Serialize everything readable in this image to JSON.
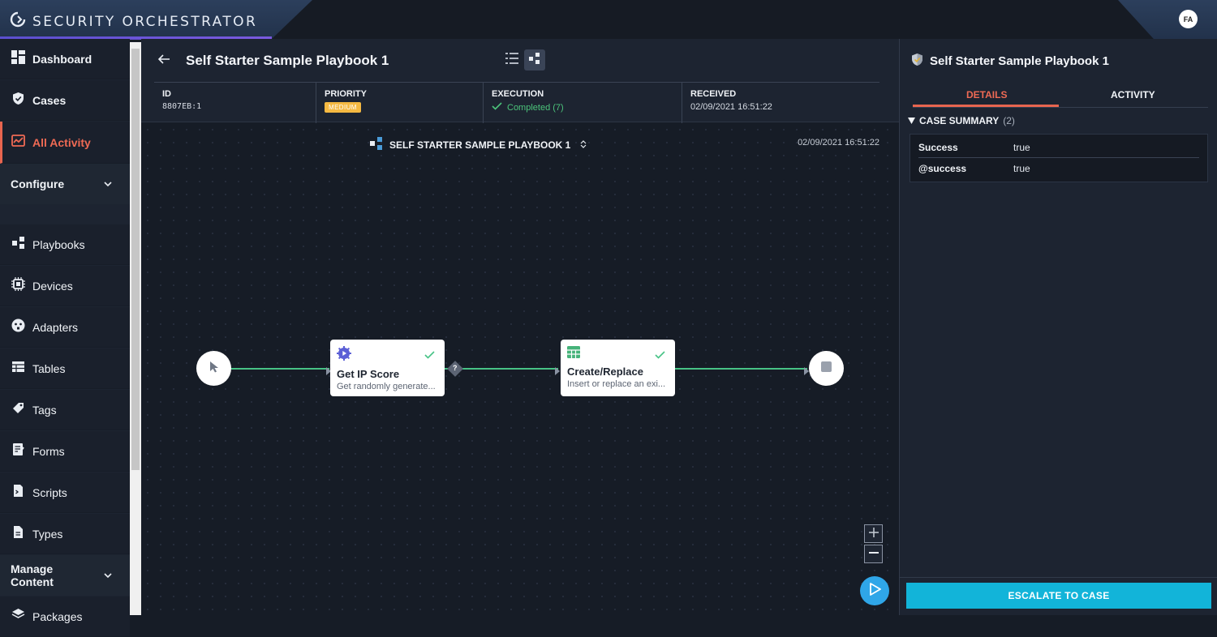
{
  "app": {
    "brand": "SECURITY ORCHESTRATOR",
    "user_initials": "FA"
  },
  "sidebar": {
    "items": [
      {
        "label": "Dashboard",
        "icon": "dashboard-icon"
      },
      {
        "label": "Cases",
        "icon": "shield-icon"
      },
      {
        "label": "All Activity",
        "icon": "activity-icon",
        "active": true
      }
    ],
    "configure_label": "Configure",
    "configure_items": [
      {
        "label": "Playbooks",
        "icon": "playbook-icon"
      },
      {
        "label": "Devices",
        "icon": "chip-icon"
      },
      {
        "label": "Adapters",
        "icon": "plug-icon"
      },
      {
        "label": "Tables",
        "icon": "table-icon"
      },
      {
        "label": "Tags",
        "icon": "tag-icon"
      },
      {
        "label": "Forms",
        "icon": "form-icon"
      },
      {
        "label": "Scripts",
        "icon": "script-icon"
      },
      {
        "label": "Types",
        "icon": "file-icon"
      }
    ],
    "manage_label": "Manage Content",
    "packages_label": "Packages"
  },
  "header": {
    "title": "Self Starter Sample Playbook 1",
    "id_label": "ID",
    "id_value": "8807EB:1",
    "priority_label": "PRIORITY",
    "priority_value": "MEDIUM",
    "execution_label": "EXECUTION",
    "execution_value": "Completed (7)",
    "received_label": "RECEIVED",
    "received_value": "02/09/2021 16:51:22"
  },
  "canvas": {
    "flow_name": "SELF STARTER SAMPLE PLAYBOOK 1",
    "flow_date": "02/09/2021 16:51:22",
    "nodes": [
      {
        "title": "Get IP Score",
        "desc": "Get randomly generate..."
      },
      {
        "title": "Create/Replace",
        "desc": "Insert or replace an exi..."
      }
    ],
    "decision_label": "?",
    "zoom_in": "+",
    "zoom_out": "—"
  },
  "panel": {
    "title": "Self Starter Sample Playbook 1",
    "tab_details": "DETAILS",
    "tab_activity": "ACTIVITY",
    "summary_label": "CASE SUMMARY",
    "summary_count": "(2)",
    "rows": [
      {
        "key": "Success",
        "value": "true"
      },
      {
        "key": "@success",
        "value": "true"
      }
    ],
    "escalate_label": "ESCALATE TO CASE"
  },
  "colors": {
    "accent": "#e8654f",
    "success": "#47c386",
    "primary": "#12b4d9",
    "medium_badge": "#f5b942"
  }
}
